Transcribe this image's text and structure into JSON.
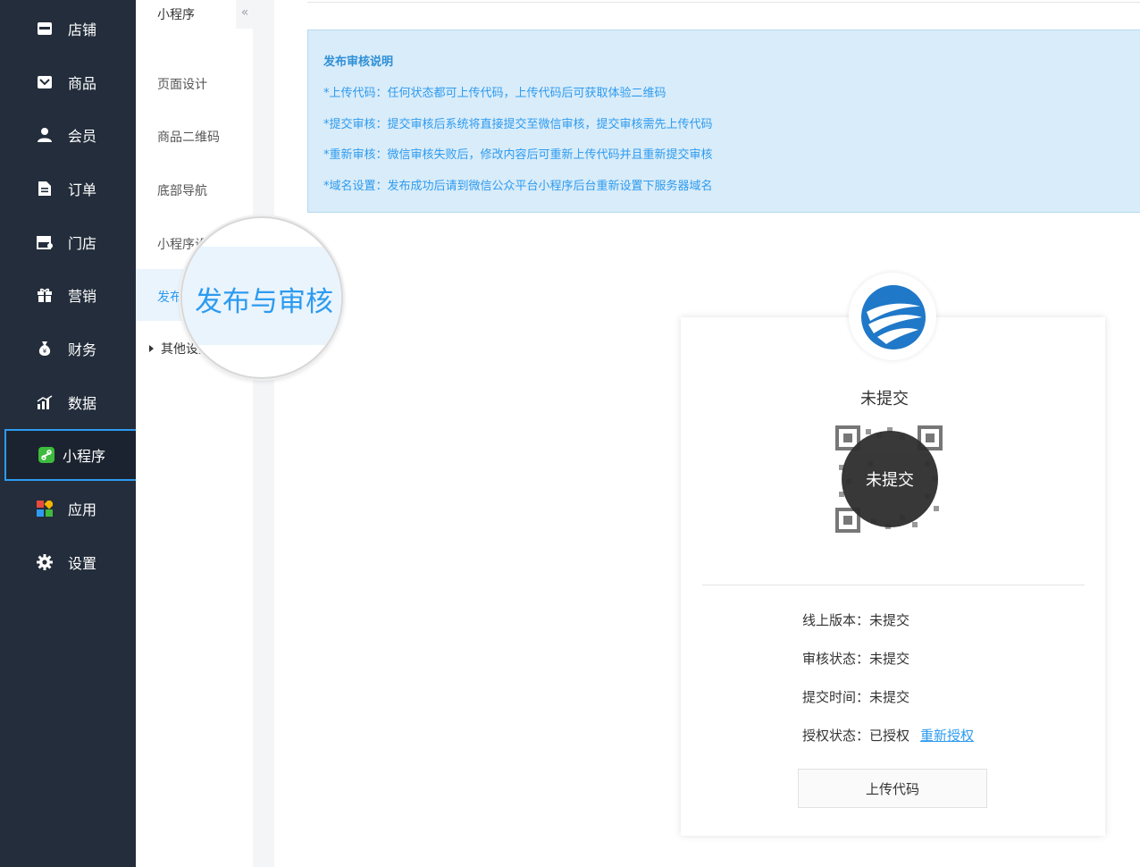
{
  "sidebar": {
    "items": [
      {
        "label": "店铺",
        "icon": "store-icon"
      },
      {
        "label": "商品",
        "icon": "product-icon"
      },
      {
        "label": "会员",
        "icon": "user-icon"
      },
      {
        "label": "订单",
        "icon": "document-icon"
      },
      {
        "label": "门店",
        "icon": "shop-icon"
      },
      {
        "label": "营销",
        "icon": "gift-icon"
      },
      {
        "label": "财务",
        "icon": "money-bag-icon"
      },
      {
        "label": "数据",
        "icon": "bar-chart-icon"
      },
      {
        "label": "小程序",
        "icon": "mini-program-icon",
        "active": true
      },
      {
        "label": "应用",
        "icon": "apps-icon"
      },
      {
        "label": "设置",
        "icon": "gear-icon"
      }
    ]
  },
  "subnav": {
    "title": "小程序",
    "collapse": "«",
    "items": [
      "页面设计",
      "商品二维码",
      "底部导航",
      "小程序设置",
      "发布与审核"
    ],
    "more": "其他设置"
  },
  "magnifier": {
    "text": "发布与审核"
  },
  "notice": {
    "title": "发布审核说明",
    "lines": [
      "*上传代码：任何状态都可上传代码，上传代码后可获取体验二维码",
      "*提交审核：提交审核后系统将直接提交至微信审核，提交审核需先上传代码",
      "*重新审核：微信审核失败后，修改内容后可重新上传代码并且重新提交审核",
      "*域名设置：发布成功后请到微信公众平台小程序后台重新设置下服务器域名"
    ]
  },
  "card": {
    "status": "未提交",
    "qr_overlay": "未提交",
    "rows": [
      {
        "label": "线上版本：",
        "value": "未提交"
      },
      {
        "label": "审核状态：",
        "value": "未提交"
      },
      {
        "label": "提交时间：",
        "value": "未提交"
      },
      {
        "label": "授权状态：",
        "value": "已授权"
      }
    ],
    "reauth_link": "重新授权",
    "upload_button": "上传代码"
  },
  "colors": {
    "sidebar_bg": "#232d3b",
    "accent": "#2d9bf0",
    "notice_bg": "#d9ecf9"
  }
}
